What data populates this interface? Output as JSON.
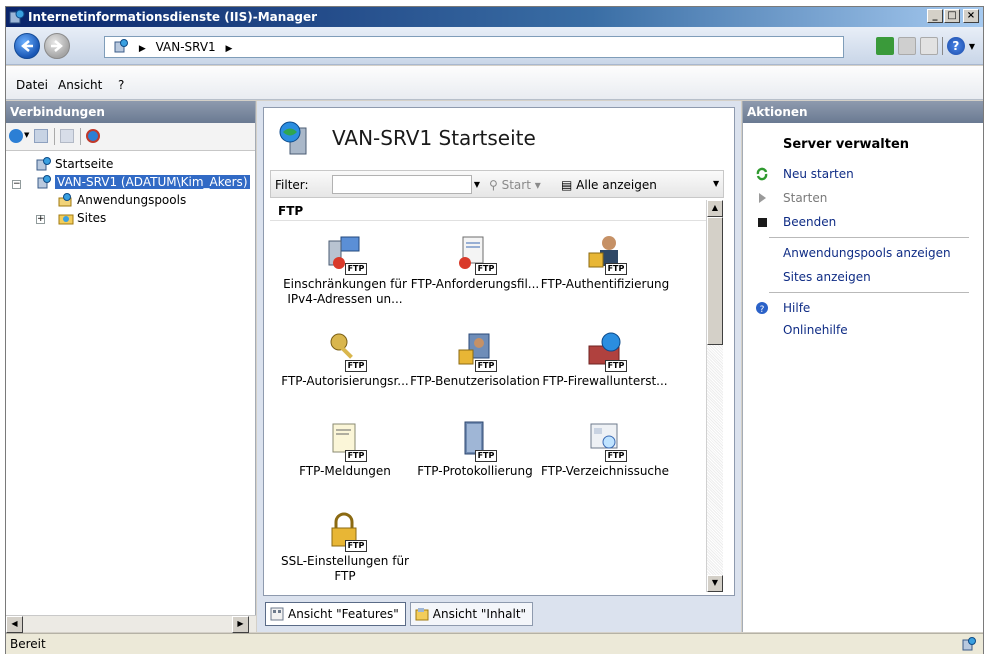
{
  "window": {
    "title": "Internetinformationsdienste (IIS)-Manager"
  },
  "address": {
    "crumbs": [
      "VAN-SRV1"
    ]
  },
  "menu": {
    "file": "Datei",
    "view": "Ansicht",
    "help": "?"
  },
  "left": {
    "title": "Verbindungen",
    "tree": [
      {
        "label": "Startseite"
      },
      {
        "label": "VAN-SRV1 (ADATUM\\Kim_Akers)"
      },
      {
        "label": "Anwendungspools"
      },
      {
        "label": "Sites"
      }
    ]
  },
  "center": {
    "page_title": "VAN-SRV1 Startseite",
    "filter_label": "Filter:",
    "start_label": "Start",
    "show_all_label": "Alle anzeigen",
    "group_label": "FTP",
    "features": [
      {
        "line1": "Einschränkungen für",
        "line2": "IPv4-Adressen un..."
      },
      {
        "line1": "FTP-Anforderungsfil...",
        "line2": ""
      },
      {
        "line1": "FTP-Authentifizierung",
        "line2": ""
      },
      {
        "line1": "FTP-Autorisierungsr...",
        "line2": ""
      },
      {
        "line1": "FTP-Benutzerisolation",
        "line2": ""
      },
      {
        "line1": "FTP-Firewallunterst...",
        "line2": ""
      },
      {
        "line1": "FTP-Meldungen",
        "line2": ""
      },
      {
        "line1": "FTP-Protokollierung",
        "line2": ""
      },
      {
        "line1": "FTP-Verzeichnissuche",
        "line2": ""
      },
      {
        "line1": "SSL-Einstellungen für",
        "line2": "FTP"
      }
    ],
    "ftp_badge": "FTP",
    "tab_features": "Ansicht \"Features\"",
    "tab_content": "Ansicht \"Inhalt\""
  },
  "right": {
    "title": "Aktionen",
    "section_head": "Server verwalten",
    "restart": "Neu starten",
    "start": "Starten",
    "stop": "Beenden",
    "show_pools": "Anwendungspools anzeigen",
    "show_sites": "Sites anzeigen",
    "help": "Hilfe",
    "online_help": "Onlinehilfe"
  },
  "status": {
    "text": "Bereit"
  },
  "colors": {
    "selection": "#316ac5",
    "pane_header": "#7b8aa2",
    "link": "#0f2c85"
  }
}
